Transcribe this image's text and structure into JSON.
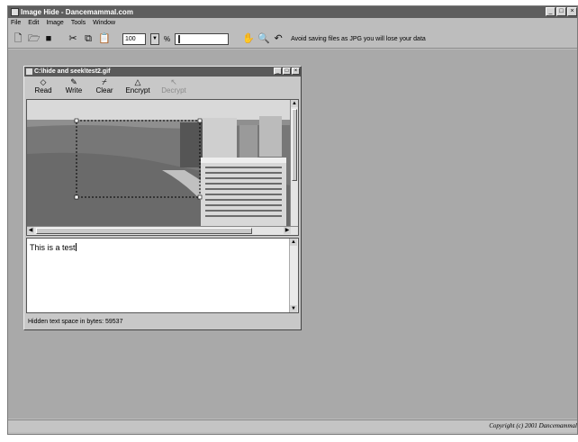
{
  "app": {
    "title": "Image Hide - Dancemammal.com"
  },
  "menu": [
    "File",
    "Edit",
    "Image",
    "Tools",
    "Window"
  ],
  "toolbar": {
    "icons": [
      "new-file-icon",
      "open-folder-icon",
      "save-icon",
      "cut-icon",
      "copy-icon",
      "paste-icon",
      "hand-pan-icon",
      "magnify-icon",
      "undo-icon"
    ],
    "zoom_value": "100",
    "zoom_unit": "%",
    "warning": "Avoid saving files as JPG you will lose your data"
  },
  "document": {
    "title": "C:\\hide and seek\\test2.gif",
    "buttons": [
      {
        "label": "Read",
        "icon": "read-icon",
        "enabled": true
      },
      {
        "label": "Write",
        "icon": "write-icon",
        "enabled": true
      },
      {
        "label": "Clear",
        "icon": "broom-icon",
        "enabled": true
      },
      {
        "label": "Encrypt",
        "icon": "lock-icon",
        "enabled": true
      },
      {
        "label": "Decrypt",
        "icon": "key-icon",
        "enabled": false
      }
    ],
    "hidden_text": "This is a test",
    "status": "Hidden text space in bytes: 59537"
  },
  "statusbar": {
    "copyright": "Copyright (c) 2001 Dancemammal"
  },
  "colors": {
    "titlebar": "#5e5e5e",
    "workspace": "#a9a9a9",
    "window_bg": "#c8c8c8"
  }
}
